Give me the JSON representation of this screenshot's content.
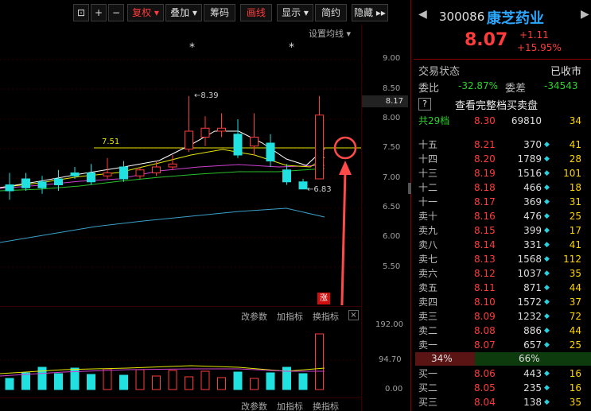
{
  "toolbar": {
    "square": "⊡",
    "plus": "+",
    "minus": "−",
    "fq": "复权",
    "overlay": "叠加",
    "chips": "筹码",
    "draw": "画线",
    "display": "显示",
    "simple": "简约",
    "hide": "隐藏",
    "more": "▸▸"
  },
  "chart": {
    "settings": "设置均线",
    "price_axis": [
      "9.00",
      "8.50",
      "8.17",
      "8.00",
      "7.50",
      "7.00",
      "6.50",
      "6.00",
      "5.50"
    ],
    "high_label": "8.39",
    "low_label": "6.83",
    "line_label": "7.51",
    "limit_badge": "涨",
    "sub1": {
      "params": "改参数",
      "add": "加指标",
      "swap": "换指标",
      "close": "×",
      "axis": [
        "192.00",
        "94.70",
        "0.00"
      ]
    },
    "sub2": {
      "params": "改参数",
      "add": "加指标",
      "swap": "换指标"
    }
  },
  "chart_data": {
    "type": "candlestick",
    "note": "",
    "ylim": [
      5.2,
      9.2
    ],
    "candles": [
      [
        6.9,
        7.1,
        6.8,
        6.65
      ],
      [
        7.0,
        7.1,
        6.85,
        6.8
      ],
      [
        6.95,
        7.05,
        6.85,
        6.75
      ],
      [
        7.0,
        7.15,
        6.9,
        6.8
      ],
      [
        7.1,
        7.2,
        7.05,
        7.0
      ],
      [
        7.1,
        7.25,
        6.95,
        6.9
      ],
      [
        7.05,
        7.35,
        7.1,
        7.0
      ],
      [
        7.2,
        7.3,
        7.0,
        6.95
      ],
      [
        7.05,
        7.2,
        7.15,
        7.0
      ],
      [
        7.1,
        7.3,
        7.2,
        7.05
      ],
      [
        7.2,
        7.4,
        7.25,
        7.15
      ],
      [
        7.5,
        8.39,
        7.8,
        7.45
      ],
      [
        7.7,
        8.05,
        7.85,
        7.55
      ],
      [
        7.8,
        8.1,
        7.85,
        7.7
      ],
      [
        7.75,
        8.0,
        7.4,
        7.35
      ],
      [
        7.55,
        8.1,
        7.7,
        7.4
      ],
      [
        7.6,
        7.75,
        7.3,
        7.2
      ],
      [
        7.15,
        7.25,
        6.95,
        6.9
      ],
      [
        6.95,
        7.0,
        6.83,
        6.83
      ],
      [
        7.0,
        8.39,
        8.07,
        7.0
      ]
    ]
  },
  "quote": {
    "code": "300086",
    "name": "康芝药业",
    "price": "8.07",
    "chg": "+1.11",
    "pct": "+15.95%",
    "status_lbl": "交易状态",
    "status": "已收市",
    "wb_lbl": "委比",
    "wb": "-32.87%",
    "wc_lbl": "委差",
    "wc": "-34543",
    "full_btn": "?",
    "full_lbl": "查看完整档买卖盘",
    "total_lbl": "共29档",
    "total_price": "8.30",
    "total_vol": "69810",
    "total_cnt": "34",
    "asks": [
      [
        "十五",
        "8.21",
        "370",
        "41"
      ],
      [
        "十四",
        "8.20",
        "1789",
        "28"
      ],
      [
        "十三",
        "8.19",
        "1516",
        "101"
      ],
      [
        "十二",
        "8.18",
        "466",
        "18"
      ],
      [
        "十一",
        "8.17",
        "369",
        "31"
      ],
      [
        "卖十",
        "8.16",
        "476",
        "25"
      ],
      [
        "卖九",
        "8.15",
        "399",
        "17"
      ],
      [
        "卖八",
        "8.14",
        "331",
        "41"
      ],
      [
        "卖七",
        "8.13",
        "1568",
        "112"
      ],
      [
        "卖六",
        "8.12",
        "1037",
        "35"
      ],
      [
        "卖五",
        "8.11",
        "871",
        "44"
      ],
      [
        "卖四",
        "8.10",
        "1572",
        "37"
      ],
      [
        "卖三",
        "8.09",
        "1232",
        "72"
      ],
      [
        "卖二",
        "8.08",
        "886",
        "44"
      ],
      [
        "卖一",
        "8.07",
        "657",
        "25"
      ]
    ],
    "buy_pct": "34%",
    "sell_pct": "66%",
    "bids": [
      [
        "买一",
        "8.06",
        "443",
        "16"
      ],
      [
        "买二",
        "8.05",
        "235",
        "16"
      ],
      [
        "买三",
        "8.04",
        "138",
        "35"
      ]
    ]
  }
}
